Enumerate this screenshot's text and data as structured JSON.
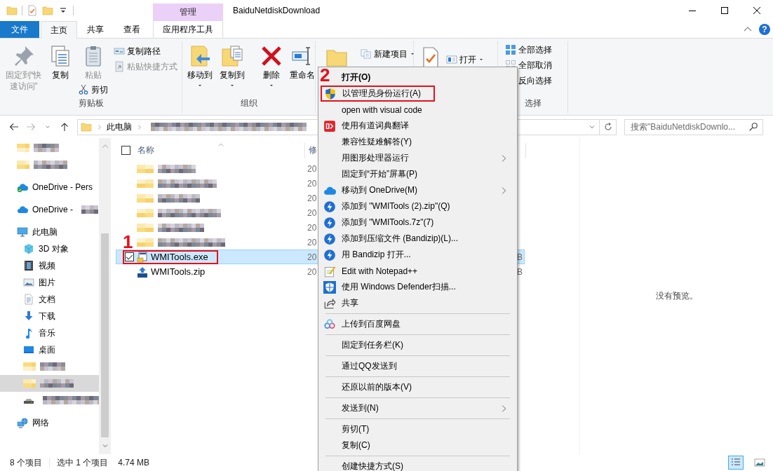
{
  "title_bar": {
    "context_tab": "管理",
    "title": "BaiduNetdiskDownload"
  },
  "tabs": [
    {
      "label": "文件",
      "kind": "file",
      "selected": false
    },
    {
      "label": "主页",
      "kind": "tab",
      "selected": true
    },
    {
      "label": "共享",
      "kind": "tab",
      "selected": false
    },
    {
      "label": "查看",
      "kind": "tab",
      "selected": false
    },
    {
      "label": "应用程序工具",
      "kind": "context",
      "selected": false
    }
  ],
  "help": "?",
  "ribbon": {
    "clipboard": {
      "pin": {
        "label": "固定到“快速访问”",
        "disabled": true
      },
      "copy": {
        "label": "复制",
        "disabled": false
      },
      "paste": {
        "label": "粘贴",
        "disabled": true
      },
      "cut": {
        "label": "剪切",
        "disabled": false
      },
      "copy_path": {
        "label": "复制路径",
        "disabled": false
      },
      "paste_shortcut": {
        "label": "粘贴快捷方式",
        "disabled": true
      },
      "label": "剪贴板"
    },
    "organize": {
      "move_to": "移动到",
      "copy_to": "复制到",
      "delete": "删除",
      "rename": "重命名",
      "label": "组织"
    },
    "new": {
      "new_item": "新建项目"
    },
    "open": {
      "open": "打开"
    },
    "select": {
      "select_all": "全部选择",
      "select_none": "全部取消",
      "invert": "反向选择",
      "label": "选择"
    }
  },
  "address": {
    "crumbs": [
      {
        "kind": "text",
        "label": "此电脑"
      },
      {
        "kind": "redacted"
      }
    ],
    "search": {
      "placeholder": "搜索\"BaiduNetdiskDownlo..."
    }
  },
  "nav": [
    {
      "kind": "redacted-folder",
      "selected": false
    },
    {
      "kind": "redacted-folder",
      "selected": false
    },
    {
      "kind": "cloud-synced",
      "label": "OneDrive - Pers",
      "selected": false
    },
    {
      "kind": "cloud",
      "label": "OneDrive -",
      "redacted_suffix": true,
      "selected": false
    },
    {
      "kind": "computer",
      "label": "此电脑",
      "selected": false,
      "children": [
        {
          "kind": "objects3d",
          "label": "3D 对象",
          "selected": false
        },
        {
          "kind": "videos",
          "label": "视频",
          "selected": false
        },
        {
          "kind": "pictures",
          "label": "图片",
          "selected": false
        },
        {
          "kind": "documents",
          "label": "文档",
          "selected": false
        },
        {
          "kind": "downloads",
          "label": "下载",
          "selected": false
        },
        {
          "kind": "music",
          "label": "音乐",
          "selected": false
        },
        {
          "kind": "desktop",
          "label": "桌面",
          "selected": false
        },
        {
          "kind": "redacted-folder",
          "selected": false
        },
        {
          "kind": "redacted-folder",
          "selected": true
        },
        {
          "kind": "redacted-drive",
          "selected": false
        }
      ]
    },
    {
      "kind": "network",
      "label": "网络",
      "selected": false
    }
  ],
  "list": {
    "header": {
      "checked": false,
      "name": "名称",
      "column_2": "修"
    },
    "rows": [
      {
        "kind": "redacted",
        "date": "20",
        "selected": false,
        "checked": false
      },
      {
        "kind": "redacted",
        "date": "20",
        "selected": false,
        "checked": false
      },
      {
        "kind": "redacted",
        "date": "20",
        "selected": false,
        "checked": false
      },
      {
        "kind": "redacted",
        "date": "20",
        "selected": false,
        "checked": false
      },
      {
        "kind": "redacted",
        "date": "20",
        "selected": false,
        "checked": false
      },
      {
        "kind": "redacted",
        "date": "20",
        "selected": false,
        "checked": false
      },
      {
        "kind": "exe",
        "name": "WMITools.exe",
        "date": "20",
        "size": "B",
        "selected": true,
        "checked": true,
        "annotation": "1"
      },
      {
        "kind": "zip",
        "name": "WMITools.zip",
        "date": "20",
        "size": "B",
        "selected": false,
        "checked": false
      }
    ]
  },
  "preview": {
    "text": "没有预览。"
  },
  "status_bar": {
    "count": "8 个项目",
    "selection": "选中 1 个项目",
    "size": "4.74 MB",
    "views": [
      {
        "kind": "details",
        "selected": true
      },
      {
        "kind": "thumbnails",
        "selected": false
      }
    ]
  },
  "context_menu": {
    "items": [
      {
        "kind": "plain",
        "label": "打开(O)",
        "bold": true,
        "submenu": false
      },
      {
        "kind": "shield",
        "label": "以管理员身份运行(A)",
        "bold": false,
        "submenu": false,
        "annotation": "2"
      },
      {
        "kind": "plain",
        "label": "open with visual code",
        "bold": false,
        "submenu": false
      },
      {
        "kind": "youdao",
        "label": "使用有道词典翻译",
        "bold": false,
        "submenu": false
      },
      {
        "kind": "plain",
        "label": "兼容性疑难解答(Y)",
        "bold": false,
        "submenu": false
      },
      {
        "kind": "plain",
        "label": "用图形处理器运行",
        "bold": false,
        "submenu": true
      },
      {
        "kind": "plain",
        "label": "固定到“开始”屏幕(P)",
        "bold": false,
        "submenu": false
      },
      {
        "kind": "onedrive",
        "label": "移动到 OneDrive(M)",
        "bold": false,
        "submenu": true
      },
      {
        "kind": "bandizip",
        "label": "添加到 \"WMITools (2).zip\"(Q)",
        "bold": false,
        "submenu": false
      },
      {
        "kind": "bandizip",
        "label": "添加到 \"WMITools.7z\"(7)",
        "bold": false,
        "submenu": false
      },
      {
        "kind": "bandizip",
        "label": "添加到压缩文件 (Bandizip)(L)...",
        "bold": false,
        "submenu": false
      },
      {
        "kind": "bandizip",
        "label": "用 Bandizip 打开...",
        "bold": false,
        "submenu": false
      },
      {
        "kind": "notepad",
        "label": "Edit with Notepad++",
        "bold": false,
        "submenu": false
      },
      {
        "kind": "defender",
        "label": "使用 Windows Defender扫描...",
        "bold": false,
        "submenu": false
      },
      {
        "kind": "share",
        "label": "共享",
        "bold": false,
        "submenu": false
      },
      {
        "kind": "separator"
      },
      {
        "kind": "baidu",
        "label": "上传到百度网盘",
        "bold": false,
        "submenu": false
      },
      {
        "kind": "separator"
      },
      {
        "kind": "plain",
        "label": "固定到任务栏(K)",
        "bold": false,
        "submenu": false
      },
      {
        "kind": "separator"
      },
      {
        "kind": "plain",
        "label": "通过QQ发送到",
        "bold": false,
        "submenu": false
      },
      {
        "kind": "separator"
      },
      {
        "kind": "plain",
        "label": "还原以前的版本(V)",
        "bold": false,
        "submenu": false
      },
      {
        "kind": "separator"
      },
      {
        "kind": "plain",
        "label": "发送到(N)",
        "bold": false,
        "submenu": true
      },
      {
        "kind": "separator"
      },
      {
        "kind": "plain",
        "label": "剪切(T)",
        "bold": false,
        "submenu": false
      },
      {
        "kind": "plain",
        "label": "复制(C)",
        "bold": false,
        "submenu": false
      },
      {
        "kind": "separator"
      },
      {
        "kind": "plain",
        "label": "创建快捷方式(S)",
        "bold": false,
        "submenu": false
      }
    ]
  }
}
